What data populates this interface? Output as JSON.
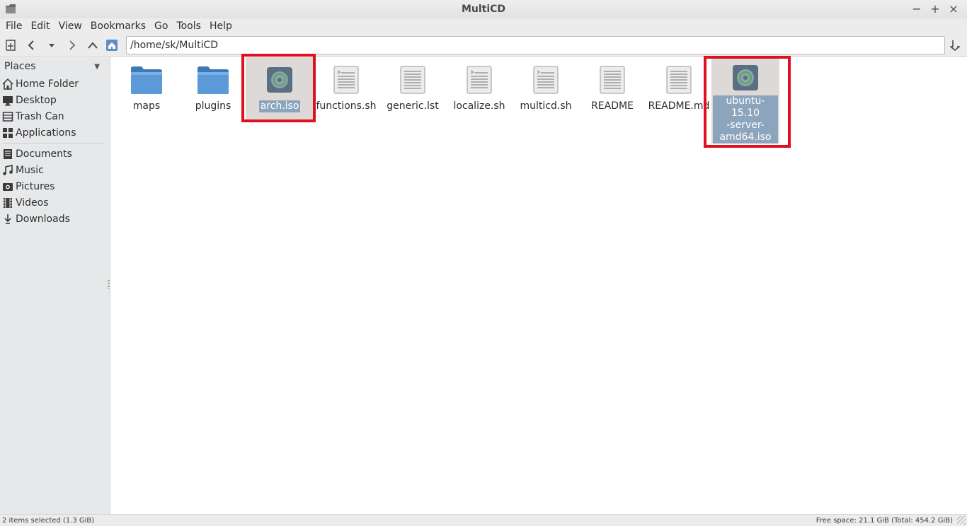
{
  "window": {
    "title": "MultiCD",
    "controls": [
      "−",
      "+",
      "×"
    ]
  },
  "menu": {
    "items": [
      "File",
      "Edit",
      "View",
      "Bookmarks",
      "Go",
      "Tools",
      "Help"
    ]
  },
  "toolbar": {
    "path": "/home/sk/MultiCD",
    "icons": [
      "new-tab-icon",
      "back-icon",
      "history-dropdown-icon",
      "forward-icon",
      "up-icon",
      "home-icon",
      "go-icon"
    ]
  },
  "sidebar": {
    "header": "Places",
    "items": [
      {
        "label": "Home Folder",
        "icon": "home-icon"
      },
      {
        "label": "Desktop",
        "icon": "desktop-icon"
      },
      {
        "label": "Trash Can",
        "icon": "trash-icon"
      },
      {
        "label": "Applications",
        "icon": "applications-icon"
      },
      {
        "label": "Documents",
        "icon": "documents-icon"
      },
      {
        "label": "Music",
        "icon": "music-icon"
      },
      {
        "label": "Pictures",
        "icon": "pictures-icon"
      },
      {
        "label": "Videos",
        "icon": "videos-icon"
      },
      {
        "label": "Downloads",
        "icon": "downloads-icon"
      }
    ]
  },
  "files": [
    {
      "name": "maps",
      "type": "folder",
      "selected": false
    },
    {
      "name": "plugins",
      "type": "folder",
      "selected": false
    },
    {
      "name": "arch.iso",
      "type": "disc-image",
      "selected": true
    },
    {
      "name": "functions.sh",
      "type": "script",
      "selected": false
    },
    {
      "name": "generic.lst",
      "type": "text",
      "selected": false
    },
    {
      "name": "localize.sh",
      "type": "script",
      "selected": false
    },
    {
      "name": "multicd.sh",
      "type": "script",
      "selected": false
    },
    {
      "name": "README",
      "type": "text",
      "selected": false
    },
    {
      "name": "README.md",
      "type": "text",
      "selected": false
    },
    {
      "name": "ubuntu-15.10-server-amd64.iso",
      "name_lines": [
        "ubuntu-15.10",
        "-server-",
        "amd64.iso"
      ],
      "type": "disc-image",
      "selected": true
    }
  ],
  "status": {
    "left": "2 items selected (1.3 GiB)",
    "right": "Free space: 21.1 GiB (Total: 454.2 GiB)"
  },
  "colors": {
    "selection_label_bg": "#8da4bd",
    "highlight_box": "#e0101e",
    "folder_blue": "#4a8fd0"
  }
}
